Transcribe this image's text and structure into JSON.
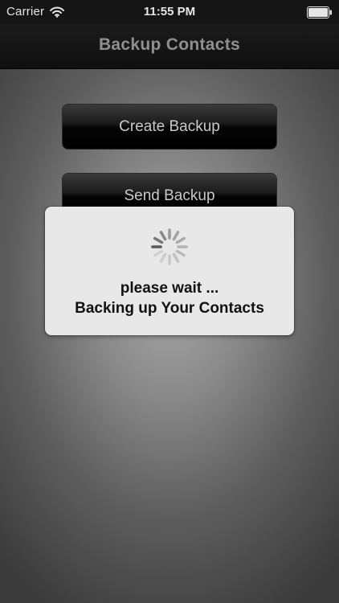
{
  "status_bar": {
    "carrier": "Carrier",
    "time": "11:55 PM",
    "wifi_icon": "wifi-icon",
    "battery_icon": "battery-full-icon"
  },
  "nav_bar": {
    "title": "Backup Contacts"
  },
  "buttons": {
    "create_backup": "Create Backup",
    "send_backup": "Send Backup"
  },
  "progress_dialog": {
    "icon": "spinner-icon",
    "title": "please wait ...",
    "message": "Backing up Your Contacts"
  },
  "colors": {
    "status_bar_bg": "#151515",
    "nav_title": "#8f8f8f",
    "button_text": "#c9c9c9",
    "dialog_bg": "#e8e8e8",
    "dialog_text": "#111111"
  }
}
